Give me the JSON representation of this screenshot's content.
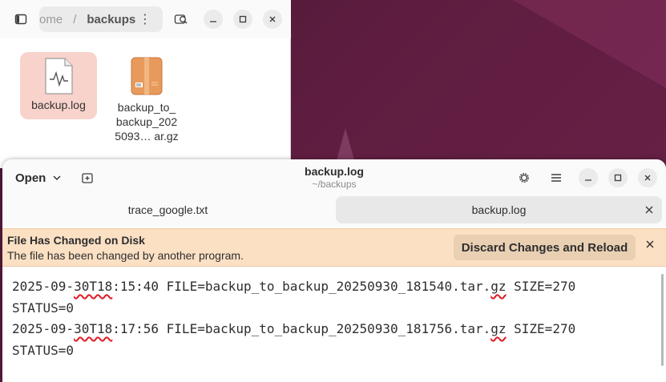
{
  "desktop": {
    "wallpaper_color": "#5e1d40"
  },
  "files": {
    "path": {
      "home_segment": "ome",
      "separator": "/",
      "current": "backups",
      "menu_icon": "⋮"
    },
    "items": [
      {
        "label": "backup.log",
        "icon": "log-file-icon"
      },
      {
        "label": "backup_to_\nbackup_202\n5093… ar.gz",
        "icon": "archive-icon"
      }
    ]
  },
  "editor": {
    "open_label": "Open",
    "title": "backup.log",
    "subtitle": "~/backups",
    "tabs": [
      {
        "label": "trace_google.txt",
        "active": false
      },
      {
        "label": "backup.log",
        "active": true
      }
    ],
    "infobar": {
      "title": "File Has Changed on Disk",
      "message": "The file has been changed by another program.",
      "button": "Discard Changes and Reload",
      "color": "#fbe0c4"
    },
    "lines": [
      {
        "a": "2025-09-",
        "b": "30T18",
        "c": ":15:40 FILE=backup_to_backup_20250930_181540.tar.",
        "d": "gz",
        "e": " SIZE=270"
      },
      {
        "a": "STATUS=0",
        "b": "",
        "c": "",
        "d": "",
        "e": ""
      },
      {
        "a": "2025-09-",
        "b": "30T18",
        "c": ":17:56 FILE=backup_to_backup_20250930_181756.tar.",
        "d": "gz",
        "e": " SIZE=270"
      },
      {
        "a": "STATUS=0",
        "b": "",
        "c": "",
        "d": "",
        "e": ""
      }
    ]
  }
}
